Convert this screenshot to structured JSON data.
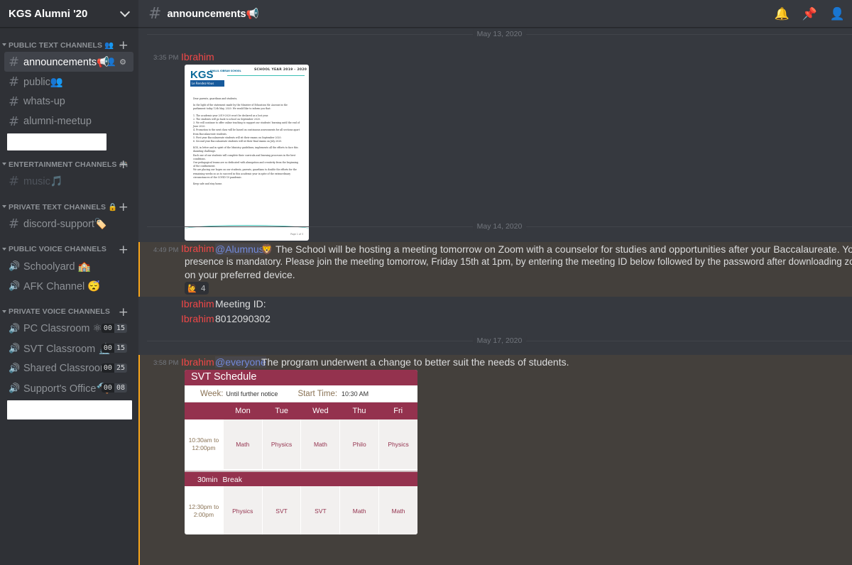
{
  "guild": {
    "name": "KGS Alumni '20"
  },
  "categories": {
    "public_text": "PUBLIC TEXT CHANNELS 👥",
    "entertainment": "ENTERTAINMENT CHANNELS 🎮",
    "private_text": "PRIVATE TEXT CHANNELS 🔒",
    "public_voice": "PUBLIC VOICE CHANNELS",
    "private_voice": "PRIVATE VOICE CHANNELS"
  },
  "text_channels": [
    "announcements📢",
    "public👥",
    "whats-up",
    "alumni-meetup"
  ],
  "entertainment_channels": [
    "music🎵"
  ],
  "private_text_channels": [
    "discord-support🏷️"
  ],
  "public_voice": [
    "Schoolyard 🏫",
    "AFK Channel 😴"
  ],
  "private_voice": [
    {
      "name": "PC Classroom ⚛",
      "a": "00",
      "b": "15"
    },
    {
      "name": "SVT Classroom 🔬",
      "a": "00",
      "b": "15"
    },
    {
      "name": "Shared Classroom...",
      "a": "00",
      "b": "25"
    },
    {
      "name": "Support's Office🔨",
      "a": "00",
      "b": "08"
    }
  ],
  "topbar": {
    "channel": "announcements📢"
  },
  "icons": {
    "bell": "bell-icon",
    "pin": "pin-icon",
    "members": "members-icon"
  },
  "messages": {
    "date1": "May 13, 2020",
    "m1_time": "3:35 PM",
    "m1_author": "Ibrahim",
    "date2": "May 14, 2020",
    "m2_time": "4:49 PM",
    "m2_author": "Ibrahim",
    "m2_mention": "@Alumnus",
    "m2_line1": "🦁  The School will be hosting a meeting tomorrow on Zoom with a counselor for studies and opportunities after your Baccalaureate. Your",
    "m2_line2": "presence is mandatory.  Please join the meeting tomorrow, Friday 15th at 1pm, by entering the meeting ID below followed by the password after downloading zoom",
    "m2_line3": "on your preferred device.",
    "m2_reaction_count": "4",
    "m3_author": "Ibrahim",
    "m3_text": "Meeting ID:",
    "m4_author": "Ibrahim",
    "m4_text": "8012090302",
    "date3": "May 17, 2020",
    "m5_time": "3:58 PM",
    "m5_author": "Ibrahim",
    "m5_mention": "@everyone",
    "m5_text": "The program underwent a change to better suit the needs of students."
  },
  "letter": {
    "logo": "KGS",
    "school": "KHALIL GIBRAN SCHOOL",
    "tag": "Le Rendez-Vous",
    "year": "SCHOOL YEAR 2019 - 2020",
    "lines": [
      "Dear parents, guardians and students,",
      "In the light of the statement made by the Minister of Education Mr. Azzouzi in the parliament today 12th May, 2020. We would like to inform you that:",
      "1. The academic year 2019-2020 won't be declared as a lost year.",
      "2. The students will go back to school on September 2020.",
      "3. We will continue to offer online teaching to support our students' learning until the end of June 2020.",
      "4. Promotion to the next class will be based on continuous assessments for all sections apart from Baccalaureate students.",
      "5. First year Baccalaureate students will sit their exams on September 2020.",
      "6. Second year Baccalaureate students will sit their final exams on July 2020.",
      "KGS, in letter and in spirit of the Ministry guidelines, implements all the efforts to face this daunting challenge.",
      "Each one of our students will complete their curricula and learning processes in the best conditions.",
      "Our pedagogical teams are so dedicated with abnegation and creativity from the beginning of the confinement.",
      "We are placing our hopes on our students, parents, guardians to double the efforts for the remaining weeks so as to succeed in this academic year in spite of the extraordinary circumstances of the COVID-19 pandemic.",
      "Keep safe and stay home."
    ],
    "page": "Page 1 of 3"
  },
  "schedule": {
    "title": "SVT Schedule",
    "week_label": "Week:",
    "week_value": "Until further notice",
    "start_label": "Start Time:",
    "start_value": "10:30 AM",
    "days": [
      "Mon",
      "Tue",
      "Wed",
      "Thu",
      "Fri"
    ],
    "slot1": "10:30am to 12:00pm",
    "slot1_cells": [
      "Math",
      "Physics",
      "Math",
      "Philo",
      "Physics"
    ],
    "break_dur": "30min",
    "break_label": "Break",
    "slot2": "12:30pm to 2:00pm",
    "slot2_cells": [
      "Physics",
      "SVT",
      "SVT",
      "Math",
      "Math"
    ]
  }
}
